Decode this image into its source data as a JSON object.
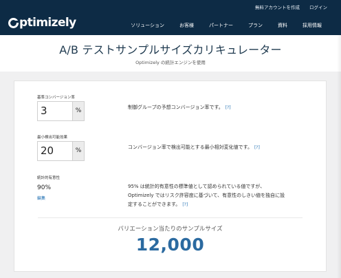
{
  "header": {
    "util_links": [
      "無料アカウントを作成",
      "ログイン"
    ],
    "logo_text": "ptimizely",
    "nav": [
      "ソリューション",
      "お客様",
      "パートナー",
      "プラン",
      "資料",
      "採用情報"
    ]
  },
  "title": {
    "main": "A/B テストサンプルサイズカリキュレーター",
    "sub": "Optimizely の統計エンジンを使用"
  },
  "fields": {
    "baseline": {
      "label": "基準コンバージョン率",
      "value": "3",
      "unit": "%",
      "description": "制御グループの予想コンバージョン率です。",
      "help": "[?]"
    },
    "mde": {
      "label": "最小検出可能効果",
      "value": "20",
      "unit": "%",
      "description": "コンバージョン率で検出可能とする最小相対変化値です。",
      "help": "[?]"
    },
    "significance": {
      "label": "統計的有意性",
      "value": "90%",
      "edit": "編集",
      "description_lines": [
        "95% は統計的有意性の標準値として認められている値ですが、",
        "Optimizely ではリスク許容度に基づいて、有意性のしきい値を独自に設",
        "定することができます。"
      ],
      "help": "[?]"
    }
  },
  "result": {
    "label": "バリエーション当たりのサンプルサイズ",
    "value": "12,000"
  },
  "colors": {
    "nav_bg": "#0d2b45",
    "accent": "#2b6aa0",
    "link": "#1f6fb2"
  }
}
